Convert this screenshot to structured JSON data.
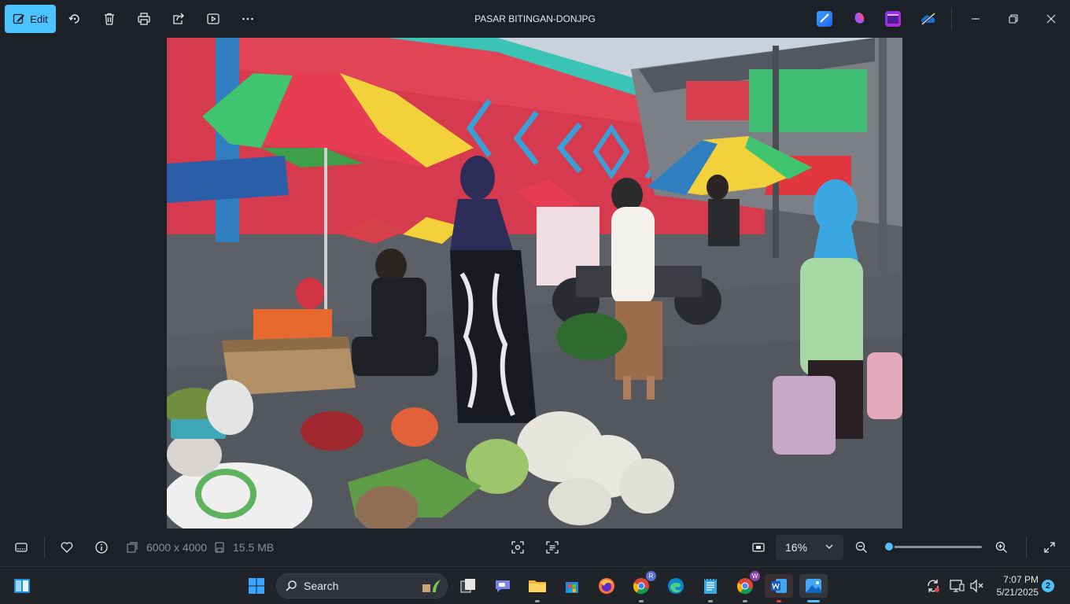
{
  "toolbar": {
    "edit_label": "Edit",
    "file_title": "PASAR BITINGAN-DONJPG",
    "icons": [
      "edit-icon",
      "rotate-icon",
      "delete-icon",
      "print-icon",
      "share-icon",
      "slideshow-icon",
      "more-icon"
    ],
    "app_icons": [
      "designer-icon",
      "clipchamp-icon",
      "video-editor-icon",
      "onedrive-icon"
    ]
  },
  "photo": {
    "subject": "Traditional market scene with colorful umbrellas, vendors and vegetables"
  },
  "statusbar": {
    "dimensions": "6000 x 4000",
    "file_size": "15.5 MB",
    "zoom": "16%",
    "zoom_slider_fraction": 0.02
  },
  "taskbar": {
    "search_label": "Search",
    "time": "7:07 PM",
    "date": "5/21/2025",
    "notification_count": "2",
    "chrome_badge_1": "R",
    "chrome_badge_2": "W"
  },
  "colors": {
    "accent": "#4cc2ff",
    "background": "#1c2027",
    "taskbar": "#202328"
  }
}
